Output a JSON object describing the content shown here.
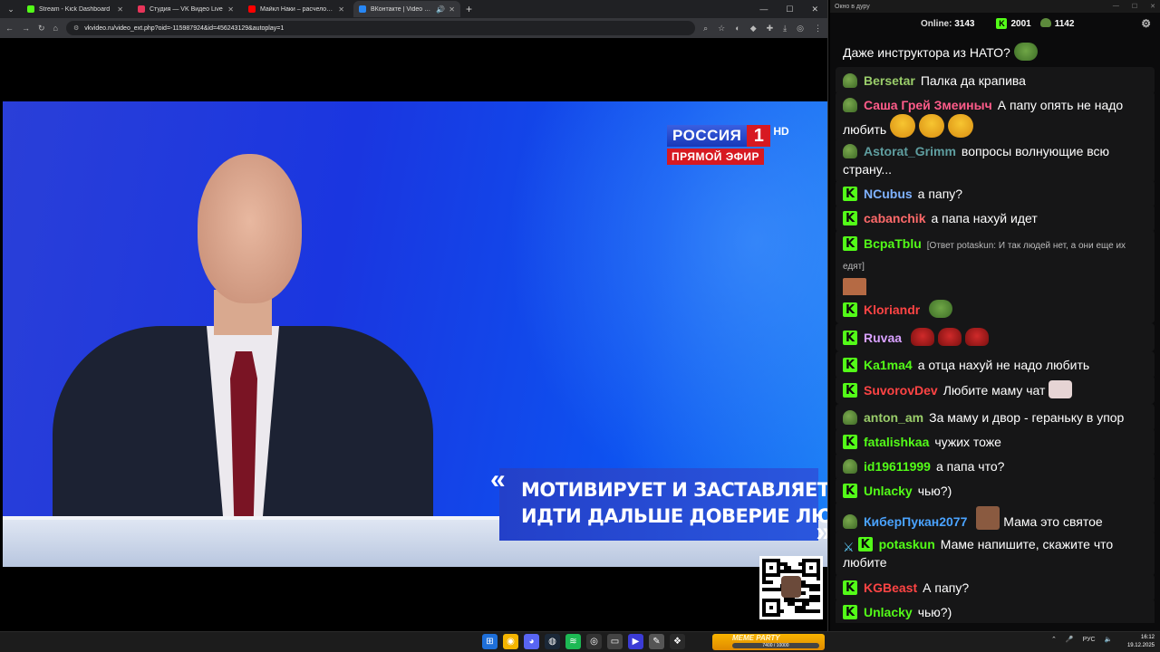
{
  "browser": {
    "tabs": [
      {
        "title": "Stream - Kick Dashboard",
        "color": "#53fc18"
      },
      {
        "title": "Студия — VK Видео Live",
        "color": "#e8355a"
      },
      {
        "title": "Майкл Наки – расчеловечив...",
        "color": "#ff0000"
      },
      {
        "title": "ВКонтакте | Video Ext",
        "color": "#2787f5"
      }
    ],
    "url": "vkvideo.ru/video_ext.php?oid=-115987924&id=456243129&autoplay=1"
  },
  "video": {
    "channel_name": "РОССИЯ",
    "channel_number": "1",
    "hd": "HD",
    "live_label": "ПРЯМОЙ ЭФИР",
    "caption_line1": "МОТИВИРУЕТ И ЗАСТАВЛЯЕТ",
    "caption_line2": "ИДТИ ДАЛЬШЕ ДОВЕРИЕ ЛЮДЕЙ",
    "quote_open": "«",
    "quote_close": "»"
  },
  "chat": {
    "window_title": "Окно в дуру",
    "online_label": "Online:",
    "online_count": "3143",
    "kick_count": "2001",
    "other_count": "1142",
    "messages": [
      {
        "badge": "none",
        "user": "",
        "color": "#ffffff",
        "text": "Даже инструктора из НАТО?",
        "emote": "pepe"
      },
      {
        "badge": "frog",
        "user": "Bersetar",
        "color": "#9acd6a",
        "text": "Палка да крапива",
        "emote": ""
      },
      {
        "badge": "frog",
        "user": "Саша Грей Змеиныч",
        "color": "#ff5c8a",
        "text": "А папу опять не надо любить",
        "emote": "laugh3"
      },
      {
        "badge": "frog",
        "user": "Astorat_Grimm",
        "color": "#5f9ea0",
        "text": "вопросы волнующие всю страну...",
        "emote": ""
      },
      {
        "badge": "kick",
        "user": "NCubus",
        "color": "#7fb2ff",
        "text": "а папу?",
        "emote": ""
      },
      {
        "badge": "kick",
        "user": "cabanchik",
        "color": "#ff6a6a",
        "text": "а папа нахуй идет",
        "emote": ""
      },
      {
        "badge": "kick",
        "user": "ВсраТblu",
        "color": "#53fc18",
        "reply": "[Ответ potaskun: И так людей нет, а они еще их едят]",
        "text": "",
        "emote": ""
      },
      {
        "badge": "kick",
        "user": "Kloriandr",
        "color": "#ff4444",
        "text": "",
        "emote": "pepe"
      },
      {
        "badge": "kick",
        "user": "Ruvaa",
        "color": "#d8a0ff",
        "text": "",
        "emote": "redpepe3"
      },
      {
        "badge": "kick",
        "user": "Ka1ma4",
        "color": "#53fc18",
        "text": "а отца нахуй не надо любить",
        "emote": ""
      },
      {
        "badge": "kick",
        "user": "SuvorovDev",
        "color": "#ff4444",
        "text": "Любите маму чат",
        "emote": "pig"
      },
      {
        "badge": "frog",
        "user": "anton_am",
        "color": "#9acd6a",
        "text": "За маму и двор - гераньку в упор",
        "emote": ""
      },
      {
        "badge": "kick",
        "user": "fatalishkaa",
        "color": "#53fc18",
        "text": "чужих тоже",
        "emote": ""
      },
      {
        "badge": "frog",
        "user": "id19611999",
        "color": "#53fc18",
        "text": "а папа что?",
        "emote": ""
      },
      {
        "badge": "kick",
        "user": "Unlacky",
        "color": "#53fc18",
        "text": "чью?)",
        "emote": ""
      },
      {
        "badge": "frog",
        "user": "КиберПукан2077",
        "color": "#4aa3ff",
        "text": "Мама это святое",
        "emote": "face"
      },
      {
        "badge": "sword-kick",
        "user": "potaskun",
        "color": "#53fc18",
        "text": "Маме напишите, скажите что любите",
        "emote": ""
      },
      {
        "badge": "kick",
        "user": "KGBeast",
        "color": "#ff4444",
        "text": "А папу?",
        "emote": ""
      },
      {
        "badge": "kick",
        "user": "Unlacky",
        "color": "#53fc18",
        "text": "чью?)",
        "emote": ""
      }
    ]
  },
  "taskbar": {
    "meme_title": "MEME PARTY",
    "meme_progress": "7400 / 10000",
    "lang": "РУС",
    "time": "16:12",
    "date": "19.12.2025"
  }
}
